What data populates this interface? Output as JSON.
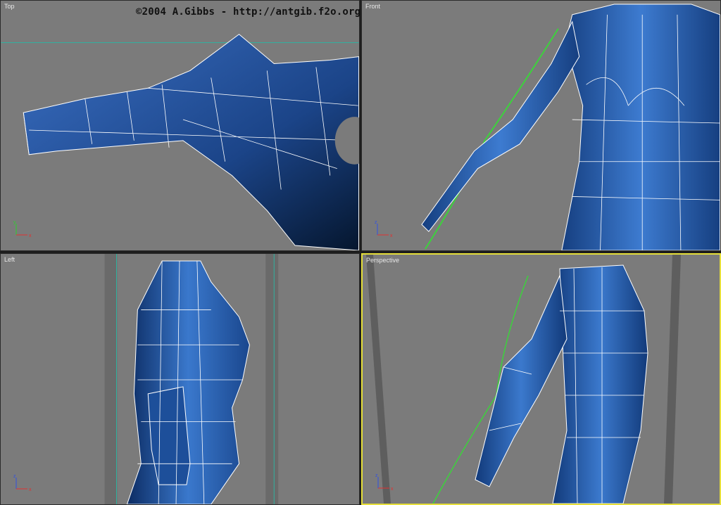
{
  "copyright": "©2004 A.Gibbs - http://antgib.f2o.org",
  "viewports": {
    "top": {
      "label": "Top"
    },
    "front": {
      "label": "Front"
    },
    "left": {
      "label": "Left"
    },
    "perspective": {
      "label": "Perspective",
      "active": true
    }
  },
  "colors": {
    "viewport_bg": "#7b7b7b",
    "mesh_blue": "#1f4f96",
    "wire": "#ffffff",
    "reference_green": "#3cd23c",
    "guide_teal": "#2fb3a0",
    "active_border": "#e6df3a"
  },
  "axis_gizmo": {
    "x": "x",
    "y": "y",
    "z": "z"
  }
}
